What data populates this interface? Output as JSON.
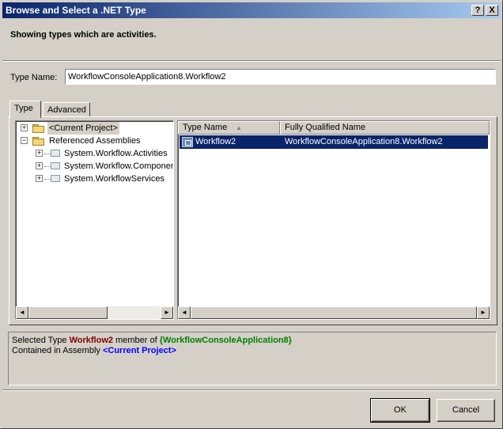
{
  "window": {
    "title": "Browse and Select a .NET Type"
  },
  "titlebar": {
    "help_label": "?",
    "close_label": "X"
  },
  "header": {
    "text": "Showing types which are activities."
  },
  "type_name": {
    "label": "Type Name:",
    "value": "WorkflowConsoleApplication8.Workflow2"
  },
  "tabs": [
    {
      "label": "Type",
      "selected": true
    },
    {
      "label": "Advanced",
      "selected": false
    }
  ],
  "tree": {
    "items": [
      {
        "label": "<Current Project>",
        "expander": "+"
      },
      {
        "label": "Referenced Assemblies",
        "expander": "−"
      },
      {
        "label": "System.Workflow.Activities",
        "expander": "+"
      },
      {
        "label": "System.Workflow.ComponentModel",
        "expander": "+"
      },
      {
        "label": "System.WorkflowServices",
        "expander": "+"
      }
    ]
  },
  "list": {
    "columns": [
      "Type Name",
      "Fully Qualified Name"
    ],
    "sort_indicator": "▲",
    "rows": [
      {
        "type_name": "Workflow2",
        "fully_qualified_name": "WorkflowConsoleApplication8.Workflow2",
        "selected": true
      }
    ]
  },
  "info": {
    "selected_prefix": "Selected Type",
    "selected_type": "Workflow2",
    "member_of": "member of",
    "namespace": "{WorkflowConsoleApplication8}",
    "contained_in": "Contained in Assembly",
    "assembly": "<Current Project>"
  },
  "buttons": {
    "ok": "OK",
    "cancel": "Cancel"
  },
  "scroll": {
    "left_arrow": "◄",
    "right_arrow": "►"
  },
  "colors": {
    "titlebar_start": "#0a246a",
    "titlebar_end": "#a6caf0",
    "selection": "#0a246a",
    "type_highlight": "#800000",
    "namespace_highlight": "#008000",
    "assembly_highlight": "#0000ff",
    "face": "#d4d0c8"
  }
}
